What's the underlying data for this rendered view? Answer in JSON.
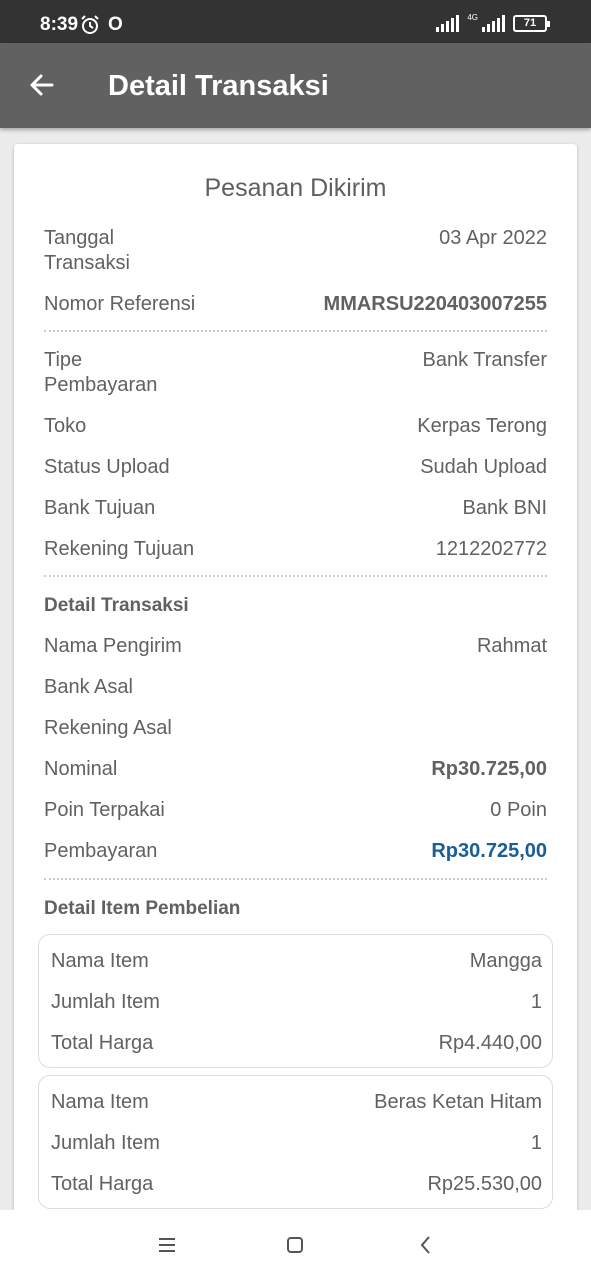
{
  "status_bar": {
    "time": "8:39",
    "network": "4G",
    "battery": "71"
  },
  "app_bar": {
    "title": "Detail Transaksi"
  },
  "order": {
    "status": "Pesanan Dikirim",
    "tanggal_label_1": "Tanggal",
    "tanggal_label_2": "Transaksi",
    "tanggal_value": "03 Apr 2022",
    "referensi_label": "Nomor Referensi",
    "referensi_value": "MMARSU220403007255",
    "tipe_label_1": "Tipe",
    "tipe_label_2": "Pembayaran",
    "tipe_value": "Bank Transfer",
    "toko_label": "Toko",
    "toko_value": "Kerpas Terong",
    "upload_label": "Status Upload",
    "upload_value": "Sudah Upload",
    "bank_tujuan_label": "Bank Tujuan",
    "bank_tujuan_value": "Bank BNI",
    "rekening_tujuan_label": "Rekening Tujuan",
    "rekening_tujuan_value": "1212202772"
  },
  "transaction": {
    "section_title": "Detail Transaksi",
    "pengirim_label": "Nama Pengirim",
    "pengirim_value": "Rahmat",
    "bank_asal_label": "Bank Asal",
    "bank_asal_value": "",
    "rekening_asal_label": "Rekening Asal",
    "rekening_asal_value": "",
    "nominal_label": "Nominal",
    "nominal_value": "Rp30.725,00",
    "poin_label": "Poin Terpakai",
    "poin_value": "0 Poin",
    "pembayaran_label": "Pembayaran",
    "pembayaran_value": "Rp30.725,00"
  },
  "items": {
    "section_title": "Detail Item Pembelian",
    "list": [
      {
        "name_label": "Nama Item",
        "name_value": "Mangga",
        "qty_label": "Jumlah Item",
        "qty_value": "1",
        "total_label": "Total Harga",
        "total_value": "Rp4.440,00"
      },
      {
        "name_label": "Nama Item",
        "name_value": "Beras Ketan Hitam",
        "qty_label": "Jumlah Item",
        "qty_value": "1",
        "total_label": "Total Harga",
        "total_value": "Rp25.530,00"
      }
    ]
  },
  "colors": {
    "app_bar": "#616161",
    "status_bar": "#333333",
    "accent_blue": "#1a5e96"
  },
  "icons": {
    "back": "arrow-left-icon",
    "nav_menu": "menu-icon",
    "nav_home": "square-icon",
    "nav_back": "chevron-left-icon"
  }
}
